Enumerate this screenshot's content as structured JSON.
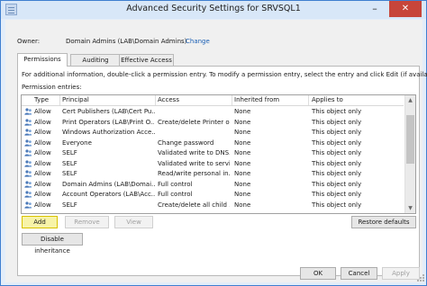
{
  "window": {
    "title": "Advanced Security Settings for SRVSQL1",
    "minimize_glyph": "–",
    "close_glyph": "✕"
  },
  "owner": {
    "label": "Owner:",
    "value": "Domain Admins (LAB\\Domain Admins)",
    "change_link": "Change"
  },
  "tabs": [
    {
      "label": "Permissions",
      "active": true
    },
    {
      "label": "Auditing",
      "active": false
    },
    {
      "label": "Effective Access",
      "active": false
    }
  ],
  "permissions": {
    "info_text": "For additional information, double-click a permission entry. To modify a permission entry, select the entry and click Edit (if available).",
    "entries_label": "Permission entries:",
    "columns": {
      "type": "Type",
      "principal": "Principal",
      "access": "Access",
      "inherited_from": "Inherited from",
      "applies_to": "Applies to"
    },
    "rows": [
      {
        "icon": "users-icon",
        "type": "Allow",
        "principal": "Cert Publishers (LAB\\Cert Pu...",
        "access": "",
        "inherited_from": "None",
        "applies_to": "This object only"
      },
      {
        "icon": "users-icon",
        "type": "Allow",
        "principal": "Print Operators (LAB\\Print O...",
        "access": "Create/delete Printer o...",
        "inherited_from": "None",
        "applies_to": "This object only"
      },
      {
        "icon": "users-icon",
        "type": "Allow",
        "principal": "Windows Authorization Acce...",
        "access": "",
        "inherited_from": "None",
        "applies_to": "This object only"
      },
      {
        "icon": "users-icon",
        "type": "Allow",
        "principal": "Everyone",
        "access": "Change password",
        "inherited_from": "None",
        "applies_to": "This object only"
      },
      {
        "icon": "users-icon",
        "type": "Allow",
        "principal": "SELF",
        "access": "Validated write to DNS...",
        "inherited_from": "None",
        "applies_to": "This object only"
      },
      {
        "icon": "users-icon",
        "type": "Allow",
        "principal": "SELF",
        "access": "Validated write to servi...",
        "inherited_from": "None",
        "applies_to": "This object only"
      },
      {
        "icon": "users-icon",
        "type": "Allow",
        "principal": "SELF",
        "access": "Read/write personal in...",
        "inherited_from": "None",
        "applies_to": "This object only"
      },
      {
        "icon": "users-icon",
        "type": "Allow",
        "principal": "Domain Admins (LAB\\Domai...",
        "access": "Full control",
        "inherited_from": "None",
        "applies_to": "This object only"
      },
      {
        "icon": "users-icon",
        "type": "Allow",
        "principal": "Account Operators (LAB\\Acc...",
        "access": "Full control",
        "inherited_from": "None",
        "applies_to": "This object only"
      },
      {
        "icon": "users-icon",
        "type": "Allow",
        "principal": "SELF",
        "access": "Create/delete all child ...",
        "inherited_from": "None",
        "applies_to": "This object only"
      }
    ],
    "buttons": {
      "add": "Add",
      "remove": "Remove",
      "view": "View",
      "restore_defaults": "Restore defaults",
      "disable_inheritance": "Disable inheritance"
    }
  },
  "dialog_buttons": {
    "ok": "OK",
    "cancel": "Cancel",
    "apply": "Apply"
  },
  "colors": {
    "title_bar": "#d8e7f8",
    "close_button": "#c7453a",
    "link": "#1a5fb4",
    "focused_button": "#f7f3a8"
  }
}
